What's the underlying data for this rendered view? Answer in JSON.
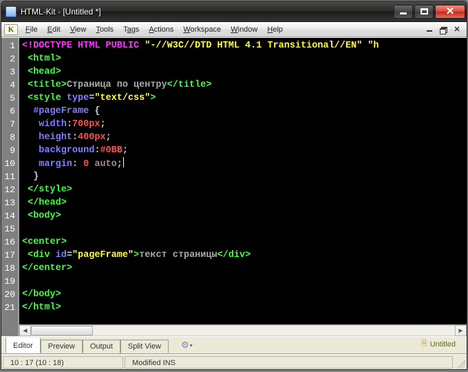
{
  "window": {
    "title": "HTML-Kit - [Untitled *]"
  },
  "menu": {
    "items": [
      {
        "label": "File",
        "accel": "F"
      },
      {
        "label": "Edit",
        "accel": "E"
      },
      {
        "label": "View",
        "accel": "V"
      },
      {
        "label": "Tools",
        "accel": "T"
      },
      {
        "label": "Tags",
        "accel": "a"
      },
      {
        "label": "Actions",
        "accel": "A"
      },
      {
        "label": "Workspace",
        "accel": "W"
      },
      {
        "label": "Window",
        "accel": "W"
      },
      {
        "label": "Help",
        "accel": "H"
      }
    ]
  },
  "editor": {
    "lines": [
      1,
      2,
      3,
      4,
      5,
      6,
      7,
      8,
      9,
      10,
      11,
      12,
      13,
      14,
      15,
      16,
      17,
      18,
      19,
      20,
      21
    ],
    "content": {
      "l1_doctype": "<!DOCTYPE HTML PUBLIC ",
      "l1_str1": "\"-//W3C//DTD HTML 4.1 Transitional//EN\"",
      "l1_str2_partial": " \"h",
      "l2": " <html>",
      "l3": " <head>",
      "l4_open": " <title>",
      "l4_text": "Страница по центру",
      "l4_close": "</title>",
      "l5_open": " <style ",
      "l5_attr": "type",
      "l5_eq": "=",
      "l5_val": "\"text/css\"",
      "l5_close": ">",
      "l6_sel": "  #pageFrame ",
      "l6_brace": "{",
      "l7_prop": "   width",
      "l7_val": "700px",
      "l8_prop": "   height",
      "l8_val": "400px",
      "l9_prop": "   background",
      "l9_val": "#0BB",
      "l10_prop": "   margin",
      "l10_val_a": " 0 ",
      "l10_val_b": "auto",
      "l11": "  }",
      "l12": " </style>",
      "l13": " </head>",
      "l14": " <body>",
      "l16": "<center>",
      "l17_open": " <div ",
      "l17_attr": "id",
      "l17_eq": "=",
      "l17_val": "\"pageFrame\"",
      "l17_gt": ">",
      "l17_text": "текст страницы",
      "l17_close": "</div>",
      "l18": "</center>",
      "l20": "</body>",
      "l21": "</html>"
    }
  },
  "tabs": {
    "items": [
      "Editor",
      "Preview",
      "Output",
      "Split View"
    ],
    "active": 0,
    "docname": "Untitled"
  },
  "status": {
    "pos": "10 : 17 (10 : 18)",
    "mode": "Modified INS"
  }
}
